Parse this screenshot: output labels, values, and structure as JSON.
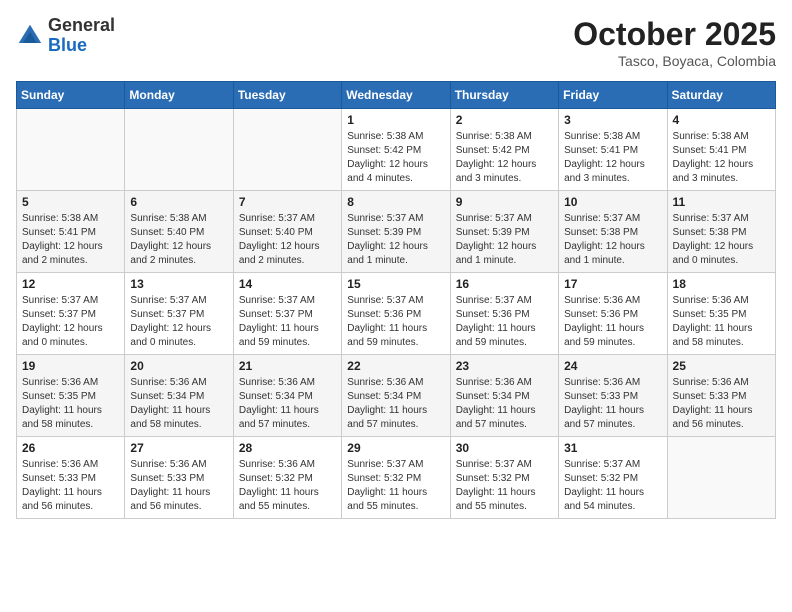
{
  "header": {
    "logo": {
      "general": "General",
      "blue": "Blue"
    },
    "title": "October 2025",
    "location": "Tasco, Boyaca, Colombia"
  },
  "weekdays": [
    "Sunday",
    "Monday",
    "Tuesday",
    "Wednesday",
    "Thursday",
    "Friday",
    "Saturday"
  ],
  "weeks": [
    [
      {
        "day": "",
        "info": ""
      },
      {
        "day": "",
        "info": ""
      },
      {
        "day": "",
        "info": ""
      },
      {
        "day": "1",
        "info": "Sunrise: 5:38 AM\nSunset: 5:42 PM\nDaylight: 12 hours\nand 4 minutes."
      },
      {
        "day": "2",
        "info": "Sunrise: 5:38 AM\nSunset: 5:42 PM\nDaylight: 12 hours\nand 3 minutes."
      },
      {
        "day": "3",
        "info": "Sunrise: 5:38 AM\nSunset: 5:41 PM\nDaylight: 12 hours\nand 3 minutes."
      },
      {
        "day": "4",
        "info": "Sunrise: 5:38 AM\nSunset: 5:41 PM\nDaylight: 12 hours\nand 3 minutes."
      }
    ],
    [
      {
        "day": "5",
        "info": "Sunrise: 5:38 AM\nSunset: 5:41 PM\nDaylight: 12 hours\nand 2 minutes."
      },
      {
        "day": "6",
        "info": "Sunrise: 5:38 AM\nSunset: 5:40 PM\nDaylight: 12 hours\nand 2 minutes."
      },
      {
        "day": "7",
        "info": "Sunrise: 5:37 AM\nSunset: 5:40 PM\nDaylight: 12 hours\nand 2 minutes."
      },
      {
        "day": "8",
        "info": "Sunrise: 5:37 AM\nSunset: 5:39 PM\nDaylight: 12 hours\nand 1 minute."
      },
      {
        "day": "9",
        "info": "Sunrise: 5:37 AM\nSunset: 5:39 PM\nDaylight: 12 hours\nand 1 minute."
      },
      {
        "day": "10",
        "info": "Sunrise: 5:37 AM\nSunset: 5:38 PM\nDaylight: 12 hours\nand 1 minute."
      },
      {
        "day": "11",
        "info": "Sunrise: 5:37 AM\nSunset: 5:38 PM\nDaylight: 12 hours\nand 0 minutes."
      }
    ],
    [
      {
        "day": "12",
        "info": "Sunrise: 5:37 AM\nSunset: 5:37 PM\nDaylight: 12 hours\nand 0 minutes."
      },
      {
        "day": "13",
        "info": "Sunrise: 5:37 AM\nSunset: 5:37 PM\nDaylight: 12 hours\nand 0 minutes."
      },
      {
        "day": "14",
        "info": "Sunrise: 5:37 AM\nSunset: 5:37 PM\nDaylight: 11 hours\nand 59 minutes."
      },
      {
        "day": "15",
        "info": "Sunrise: 5:37 AM\nSunset: 5:36 PM\nDaylight: 11 hours\nand 59 minutes."
      },
      {
        "day": "16",
        "info": "Sunrise: 5:37 AM\nSunset: 5:36 PM\nDaylight: 11 hours\nand 59 minutes."
      },
      {
        "day": "17",
        "info": "Sunrise: 5:36 AM\nSunset: 5:36 PM\nDaylight: 11 hours\nand 59 minutes."
      },
      {
        "day": "18",
        "info": "Sunrise: 5:36 AM\nSunset: 5:35 PM\nDaylight: 11 hours\nand 58 minutes."
      }
    ],
    [
      {
        "day": "19",
        "info": "Sunrise: 5:36 AM\nSunset: 5:35 PM\nDaylight: 11 hours\nand 58 minutes."
      },
      {
        "day": "20",
        "info": "Sunrise: 5:36 AM\nSunset: 5:34 PM\nDaylight: 11 hours\nand 58 minutes."
      },
      {
        "day": "21",
        "info": "Sunrise: 5:36 AM\nSunset: 5:34 PM\nDaylight: 11 hours\nand 57 minutes."
      },
      {
        "day": "22",
        "info": "Sunrise: 5:36 AM\nSunset: 5:34 PM\nDaylight: 11 hours\nand 57 minutes."
      },
      {
        "day": "23",
        "info": "Sunrise: 5:36 AM\nSunset: 5:34 PM\nDaylight: 11 hours\nand 57 minutes."
      },
      {
        "day": "24",
        "info": "Sunrise: 5:36 AM\nSunset: 5:33 PM\nDaylight: 11 hours\nand 57 minutes."
      },
      {
        "day": "25",
        "info": "Sunrise: 5:36 AM\nSunset: 5:33 PM\nDaylight: 11 hours\nand 56 minutes."
      }
    ],
    [
      {
        "day": "26",
        "info": "Sunrise: 5:36 AM\nSunset: 5:33 PM\nDaylight: 11 hours\nand 56 minutes."
      },
      {
        "day": "27",
        "info": "Sunrise: 5:36 AM\nSunset: 5:33 PM\nDaylight: 11 hours\nand 56 minutes."
      },
      {
        "day": "28",
        "info": "Sunrise: 5:36 AM\nSunset: 5:32 PM\nDaylight: 11 hours\nand 55 minutes."
      },
      {
        "day": "29",
        "info": "Sunrise: 5:37 AM\nSunset: 5:32 PM\nDaylight: 11 hours\nand 55 minutes."
      },
      {
        "day": "30",
        "info": "Sunrise: 5:37 AM\nSunset: 5:32 PM\nDaylight: 11 hours\nand 55 minutes."
      },
      {
        "day": "31",
        "info": "Sunrise: 5:37 AM\nSunset: 5:32 PM\nDaylight: 11 hours\nand 54 minutes."
      },
      {
        "day": "",
        "info": ""
      }
    ]
  ]
}
